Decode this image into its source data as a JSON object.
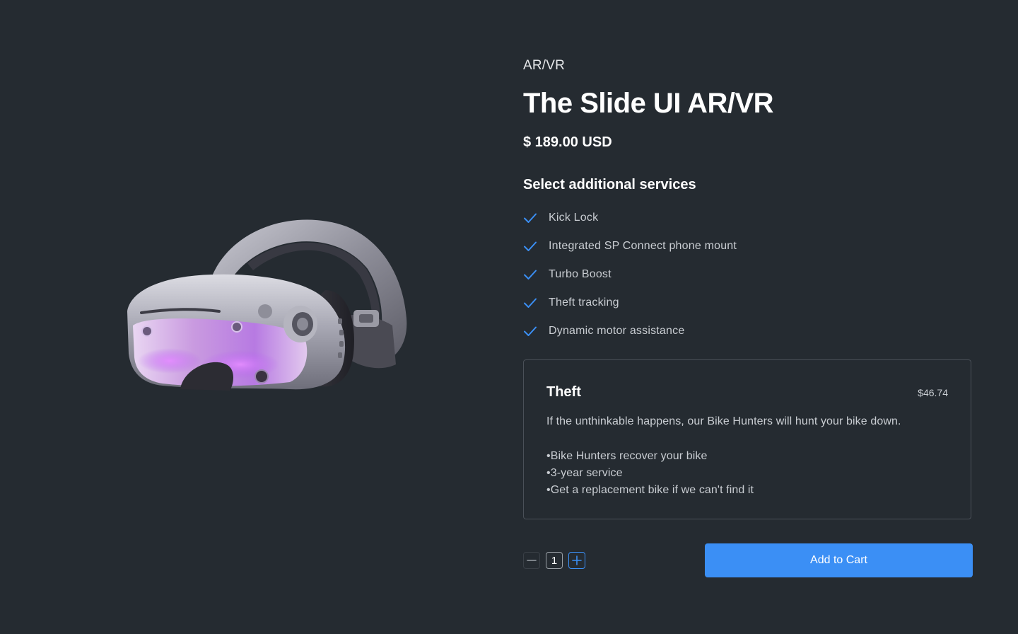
{
  "product": {
    "category": "AR/VR",
    "title": "The Slide UI AR/VR",
    "price": "$ 189.00 USD",
    "image_alt_icon": "vr-headset-image"
  },
  "services": {
    "heading": "Select additional services",
    "items": [
      {
        "label": "Kick Lock",
        "checked": true
      },
      {
        "label": "Integrated SP Connect phone mount",
        "checked": true
      },
      {
        "label": "Turbo Boost",
        "checked": true
      },
      {
        "label": "Theft tracking",
        "checked": true
      },
      {
        "label": "Dynamic motor assistance",
        "checked": true
      }
    ],
    "check_icon": "check-icon",
    "accent_color": "#3b8ff5"
  },
  "card": {
    "title": "Theft",
    "price": "$46.74",
    "description": "If the unthinkable happens, our Bike Hunters will hunt your bike down.",
    "bullets": [
      "Bike Hunters recover your bike",
      "3-year service",
      "Get a replacement bike if we can't find it"
    ]
  },
  "quantity": {
    "value": "1",
    "minus_icon": "minus-icon",
    "plus_icon": "plus-icon"
  },
  "cart": {
    "button_label": "Add to Cart",
    "button_color": "#3b8ff5"
  },
  "colors": {
    "background": "#252b31",
    "card_border": "#4a5058"
  }
}
